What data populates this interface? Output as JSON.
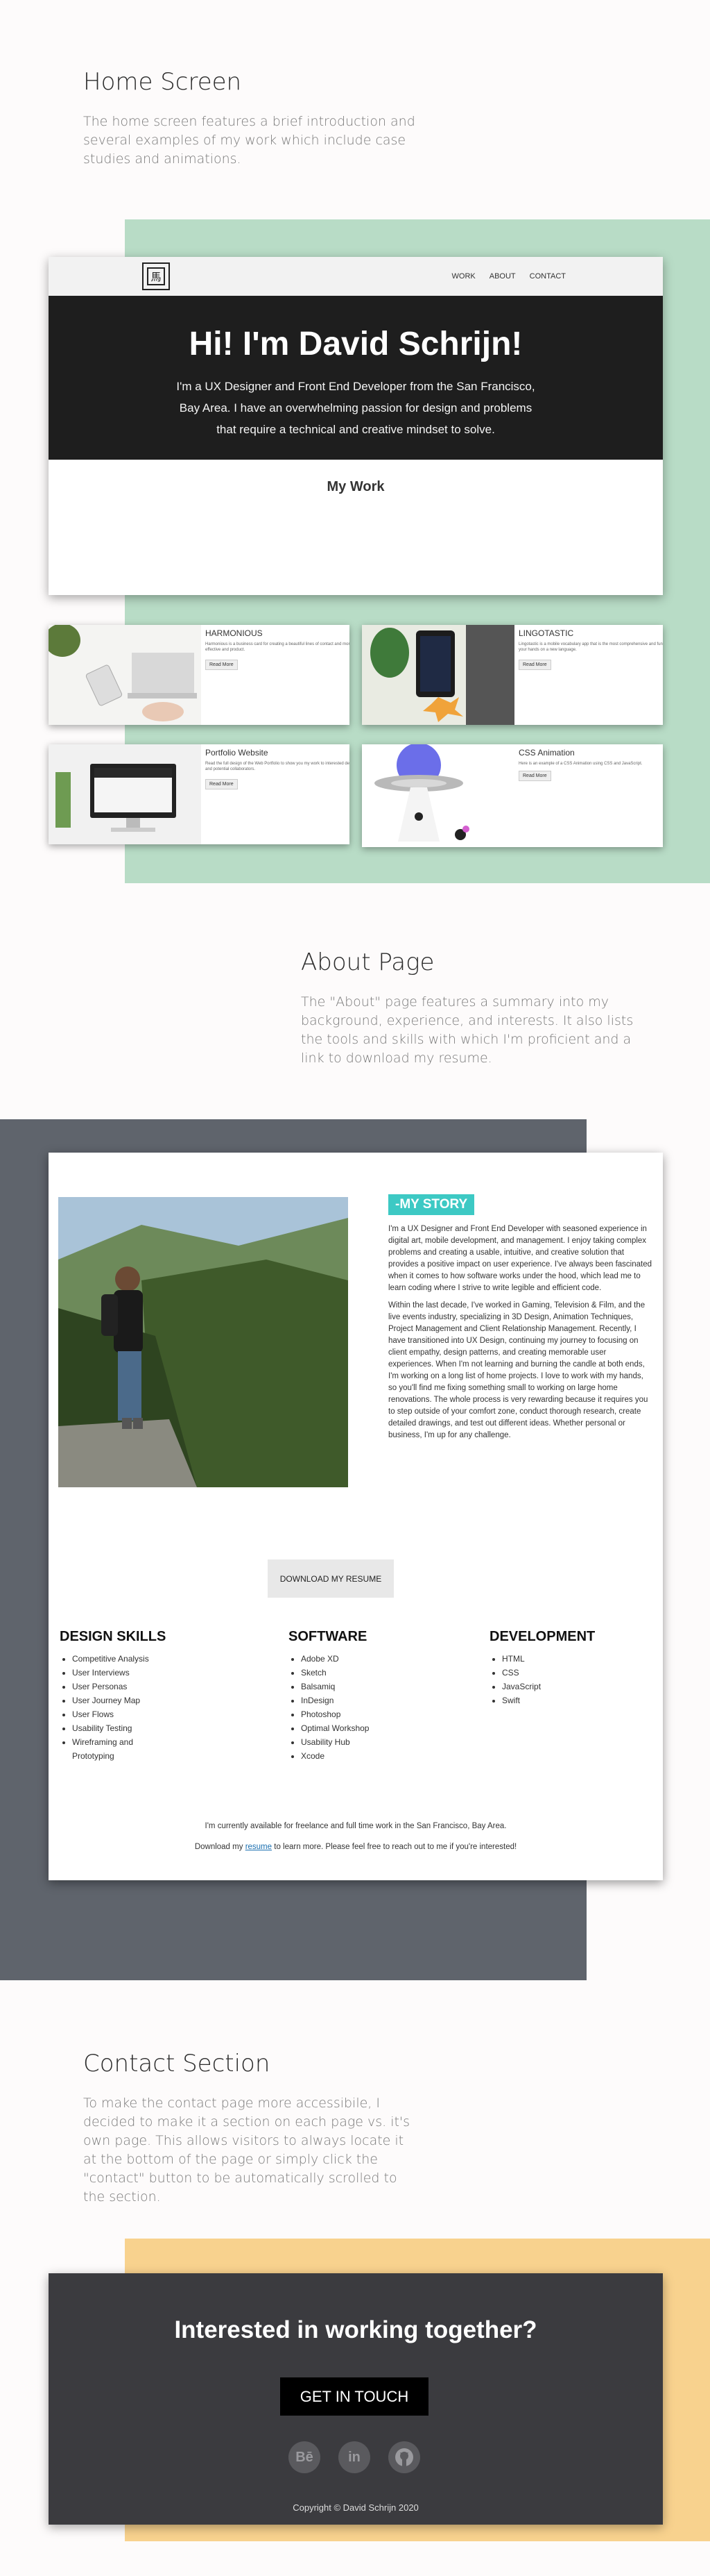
{
  "home": {
    "title": "Home Screen",
    "description": "The home screen features a brief introduction and several examples of my work which include case studies and animations.",
    "nav": [
      "WORK",
      "ABOUT",
      "CONTACT"
    ],
    "hero_title": "Hi! I'm David Schrijn!",
    "hero_text": "I'm a UX Designer and Front End Developer from the San Francisco, Bay Area. I have an overwhelming passion for design and problems that require a technical and creative mindset to solve.",
    "section_heading": "My Work",
    "projects": [
      {
        "title": "HARMONIOUS",
        "desc": "Harmonious is a business card for creating a beautiful lines of contact and more; the most effective and product.",
        "button": "Read More"
      },
      {
        "title": "LINGOTASTIC",
        "desc": "Lingotastic is a mobile vocabulary app that is the most comprehensive and fun way to get your hands on a new language.",
        "button": "Read More"
      },
      {
        "title": "Portfolio Website",
        "desc": "Read the full design of the Web Portfolio to show you my work to interested developers and potential collaborators.",
        "button": "Read More"
      },
      {
        "title": "CSS Animation",
        "desc": "Here is an example of a CSS Animation using CSS and JavaScript.",
        "button": "Read More"
      }
    ]
  },
  "about": {
    "title": "About Page",
    "description": "The \"About\" page features a summary into my background, experience, and interests. It also lists the tools and skills with which I'm proficient and a link to download my resume.",
    "story_tag": "-MY STORY",
    "story_p1": "I'm a UX Designer and Front End Developer with seasoned experience in digital art, mobile development, and management. I enjoy taking complex problems and creating a usable, intuitive, and creative solution that provides a positive impact on user experience. I've always been fascinated when it comes to how software works under the hood, which lead me to learn coding where I strive to write legible and efficient code.",
    "story_p2": "Within the last decade, I've worked in Gaming, Television & Film, and the live events industry, specializing in 3D Design, Animation Techniques, Project Management and Client Relationship Management. Recently, I have transitioned into UX Design, continuing my journey to focusing on client empathy, design patterns, and creating memorable user experiences. When I'm not learning and burning the candle at both ends, I'm working on a long list of home projects. I love to work with my hands, so you'll find me fixing something small to working on large home renovations. The whole process is very rewarding because it requires you to step outside of your comfort zone, conduct thorough research, create detailed drawings, and test out different ideas. Whether personal or business, I'm up for any challenge.",
    "download_label": "DOWNLOAD MY RESUME",
    "skills": {
      "design_title": "DESIGN SKILLS",
      "design": [
        "Competitive Analysis",
        "User Interviews",
        "User Personas",
        "User Journey Map",
        "User Flows",
        "Usability Testing",
        "Wireframing and Prototyping"
      ],
      "software_title": "SOFTWARE",
      "software": [
        "Adobe XD",
        "Sketch",
        "Balsamiq",
        "InDesign",
        "Photoshop",
        "Optimal Workshop",
        "Usability Hub",
        "Xcode"
      ],
      "dev_title": "DEVELOPMENT",
      "dev": [
        "HTML",
        "CSS",
        "JavaScript",
        "Swift"
      ]
    },
    "availability": "I'm currently available for freelance and full time work in the San Francisco, Bay Area.",
    "download_prefix": "Download my",
    "download_link": "resume",
    "download_suffix": "to learn more. Please feel free to reach out to me if you're interested!"
  },
  "contact": {
    "title": "Contact Section",
    "description": "To make the contact page more accessibile, I decided to make it a section on each page vs. it's own page.  This allows visitors to always locate it at the bottom of the page or simply click the \"contact\" button to be automatically scrolled to the section.",
    "heading": "Interested in working together?",
    "button": "GET IN TOUCH",
    "social": {
      "behance": "Bē",
      "linkedin": "in"
    },
    "copyright": "Copyright © David Schrijn 2020"
  },
  "colors": {
    "green": "#b8dcc6",
    "gray": "#5f646c",
    "yellow": "#f8d28e",
    "teal": "#3dc9c4"
  }
}
